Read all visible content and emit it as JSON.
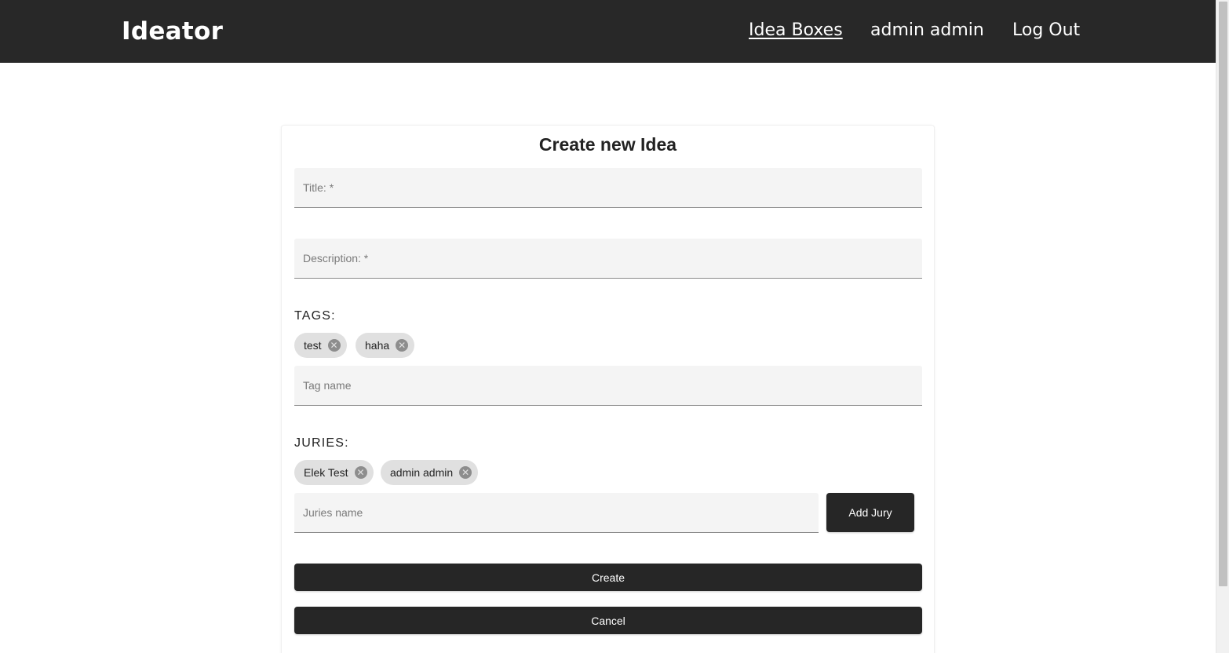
{
  "navbar": {
    "brand": "Ideator",
    "links": {
      "idea_boxes": "Idea Boxes",
      "user": "admin admin",
      "logout": "Log Out"
    }
  },
  "form": {
    "title": "Create new Idea",
    "title_field": {
      "placeholder": "Title: *",
      "value": ""
    },
    "description_field": {
      "placeholder": "Description: *",
      "value": ""
    },
    "tags": {
      "label": "TAGS:",
      "chips": [
        "test",
        "haha"
      ],
      "input_placeholder": "Tag name"
    },
    "juries": {
      "label": "JURIES:",
      "chips": [
        "Elek Test",
        "admin admin"
      ],
      "input_placeholder": "Juries name",
      "add_button": "Add Jury"
    },
    "create_button": "Create",
    "cancel_button": "Cancel"
  },
  "icons": {
    "chip_delete": "cancel-circle-icon"
  },
  "colors": {
    "navbar_bg": "#282828",
    "button_bg": "#262626",
    "chip_bg": "#e0e0e0",
    "field_bg": "#f4f4f4"
  }
}
